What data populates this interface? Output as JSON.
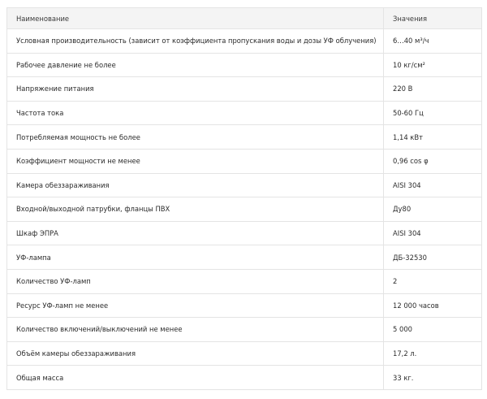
{
  "table": {
    "headers": {
      "name": "Наименование",
      "value": "Значения"
    },
    "rows": [
      {
        "name": "Условная производительность (зависит от коэффициента пропускания воды и дозы УФ облучения)",
        "value": "6…40 м³/ч"
      },
      {
        "name": "Рабочее давление не более",
        "value": "10 кг/см²"
      },
      {
        "name": "Напряжение питания",
        "value": "220 В"
      },
      {
        "name": "Частота тока",
        "value": "50-60 Гц"
      },
      {
        "name": "Потребляемая мощность не более",
        "value": "1,14 кВт"
      },
      {
        "name": "Коэффициент мощности не менее",
        "value": "0,96 cos φ"
      },
      {
        "name": "Камера обеззараживания",
        "value": "AISI 304"
      },
      {
        "name": "Входной/выходной патрубки, фланцы ПВХ",
        "value": "Ду80"
      },
      {
        "name": "Шкаф ЭПРА",
        "value": "AISI 304"
      },
      {
        "name": "УФ-лампа",
        "value": "ДБ-32530"
      },
      {
        "name": "Количество УФ-ламп",
        "value": "2"
      },
      {
        "name": "Ресурс УФ-ламп не менее",
        "value": "12 000 часов"
      },
      {
        "name": "Количество включений/выключений не менее",
        "value": "5 000"
      },
      {
        "name": "Объём камеры обеззараживания",
        "value": "17,2 л."
      },
      {
        "name": "Общая масса",
        "value": "33 кг."
      }
    ]
  }
}
